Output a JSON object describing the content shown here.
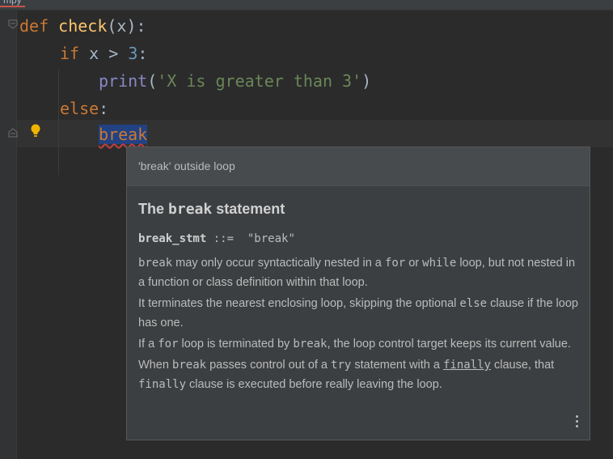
{
  "tab": {
    "label": "mpy"
  },
  "code": {
    "line1": {
      "kw": "def",
      "name": "check",
      "args": "(x):"
    },
    "line2": {
      "kw": "if",
      "cond_a": " x > ",
      "num": "3",
      "colon": ":"
    },
    "line3": {
      "fn": "print",
      "open": "(",
      "str": "'X is greater than 3'",
      "close": ")"
    },
    "line4": {
      "kw": "else",
      "colon": ":"
    },
    "line5": {
      "kw": "break"
    }
  },
  "popup": {
    "error": "'break' outside loop",
    "title_prefix": "The ",
    "title_code": "break",
    "title_suffix": " statement",
    "grammar_name": "break_stmt",
    "grammar_op": " ::=  ",
    "grammar_value": "\"break\"",
    "p1": {
      "c1": "break",
      "t1": " may only occur syntactically nested in a ",
      "c2": "for",
      "t2": " or ",
      "c3": "while",
      "t3": " loop, but not nested in a function or class definition within that loop."
    },
    "p2": {
      "t1": "It terminates the nearest enclosing loop, skipping the optional ",
      "c1": "else",
      "t2": " clause if the loop has one."
    },
    "p3": {
      "t1": "If a ",
      "c1": "for",
      "t2": " loop is terminated by ",
      "c2": "break",
      "t3": ", the loop control target keeps its current value."
    },
    "p4": {
      "t1": "When ",
      "c1": "break",
      "t2": " passes control out of a ",
      "c2": "try",
      "t3": " statement with a ",
      "c3": "finally",
      "t4": " clause, that ",
      "c4": "finally",
      "t5": " clause is executed before really leaving the loop."
    }
  },
  "colors": {
    "keyword": "#cc7832",
    "function": "#ffc66d",
    "string": "#6a8759",
    "number": "#6897bb",
    "builtin": "#8888c6",
    "selection": "#214283"
  },
  "icons": [
    "fold-icon",
    "lightbulb-icon",
    "more-options-icon"
  ]
}
